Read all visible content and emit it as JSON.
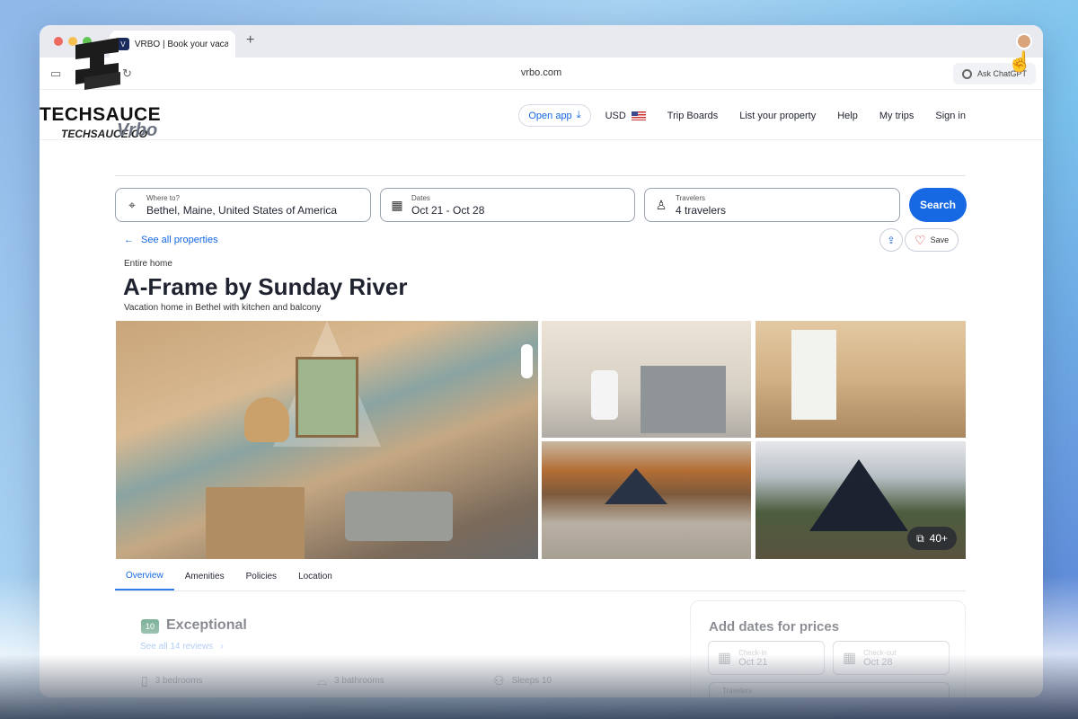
{
  "browser": {
    "tab_title": "VRBO | Book your vaca",
    "new_tab": "+",
    "url": "vrbo.com",
    "ask_chatgpt": "Ask ChatGPT"
  },
  "watermark": {
    "brand": "TECHSAUCE",
    "sub": "TECHSAUCE.CO"
  },
  "site": {
    "logo": "Vrbo",
    "open_app": "Open app",
    "currency": "USD",
    "nav": [
      "Trip Boards",
      "List your property",
      "Help",
      "My trips",
      "Sign in"
    ]
  },
  "search": {
    "destination_label": "Where to?",
    "destination_value": "Bethel, Maine, United States of America",
    "dates_label": "Dates",
    "dates_value": "Oct 21 - Oct 28",
    "travelers_label": "Travelers",
    "travelers_value": "4 travelers",
    "button": "Search"
  },
  "listing": {
    "back_link": "See all properties",
    "save": "Save",
    "type": "Entire home",
    "title": "A-Frame by Sunday River",
    "subtitle": "Vacation home in Bethel with kitchen and balcony",
    "photo_count": "40+"
  },
  "tabs": [
    "Overview",
    "Amenities",
    "Policies",
    "Location"
  ],
  "rating": {
    "score": "10",
    "label": "Exceptional",
    "reviews": "See all 14 reviews"
  },
  "features": [
    {
      "icon": "door-icon",
      "text": "3 bedrooms"
    },
    {
      "icon": "bathtub-icon",
      "text": "3 bathrooms"
    },
    {
      "icon": "people-icon",
      "text": "Sleeps 10"
    }
  ],
  "price_card": {
    "title": "Add dates for prices",
    "checkin_label": "Check-in",
    "checkin_value": "Oct 21",
    "checkout_label": "Check-out",
    "checkout_value": "Oct 28",
    "travelers_label": "Travelers"
  },
  "colors": {
    "accent": "#1668e3",
    "score_badge": "#227950"
  }
}
